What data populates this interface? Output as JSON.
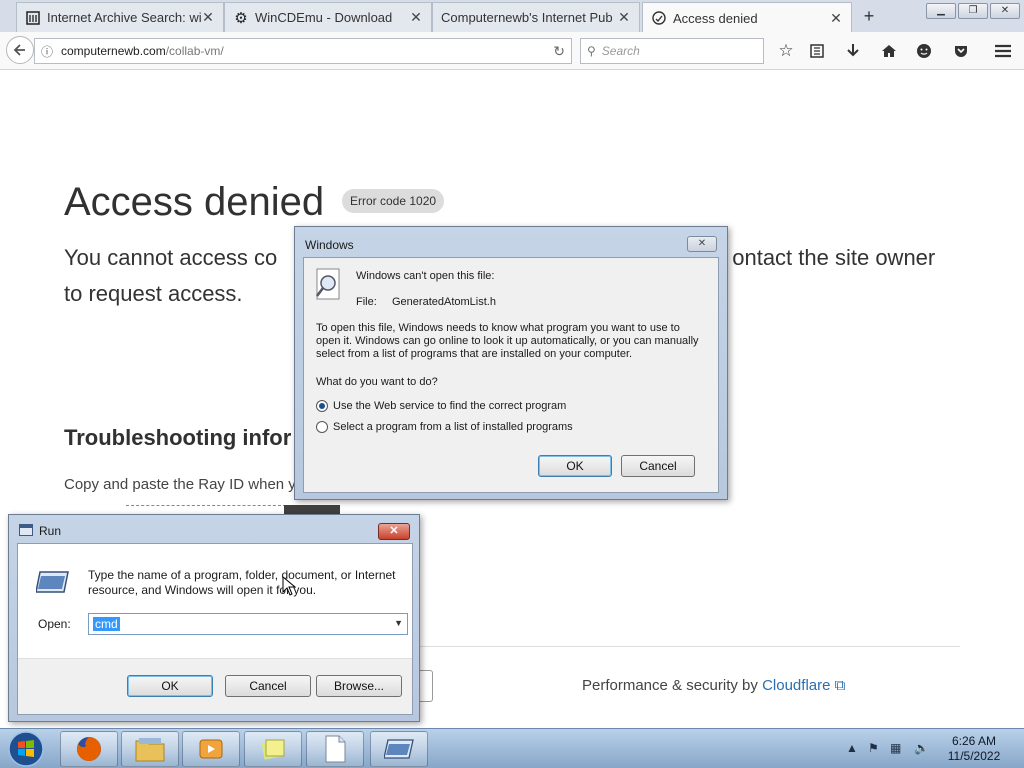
{
  "browser": {
    "tabs": [
      {
        "title": "Internet Archive Search: wi..."
      },
      {
        "title": "WinCDEmu - Download"
      },
      {
        "title": "Computernewb's Internet Pub ..."
      },
      {
        "title": "Access denied"
      }
    ],
    "url_host": "computernewb.com",
    "url_path": "/collab-vm/",
    "search_placeholder": "Search"
  },
  "page": {
    "title": "Access denied",
    "error_code": "Error code 1020",
    "message": "You cannot access co",
    "message_right": "ontact the site owner",
    "message_line2": "to request access.",
    "troubleshoot_heading": "Troubleshooting infor",
    "copy_text": "Copy and paste the Ray ID when y",
    "footer_text": "Performance & security by",
    "footer_link": "Cloudflare"
  },
  "windows_dialog": {
    "title": "Windows",
    "cant_open": "Windows can't open this file:",
    "file_label": "File:",
    "file_name": "GeneratedAtomList.h",
    "description": "To open this file, Windows needs to know what program you want to use to open it. Windows can go online to look it up automatically, or you can manually select from a list of programs that are installed on your computer.",
    "question": "What do you want to do?",
    "options": [
      {
        "label": "Use the Web service to find the correct program",
        "selected": true
      },
      {
        "label": "Select a program from a list of installed programs",
        "selected": false
      }
    ],
    "ok": "OK",
    "cancel": "Cancel"
  },
  "run_dialog": {
    "title": "Run",
    "description": "Type the name of a program, folder, document, or Internet resource, and Windows will open it for you.",
    "open_label": "Open:",
    "input_value": "cmd",
    "ok": "OK",
    "cancel": "Cancel",
    "browse": "Browse..."
  },
  "taskbar": {
    "time": "6:26 AM",
    "date": "11/5/2022"
  },
  "colors": {
    "link": "#2a6fb0",
    "selection": "#3399ff",
    "taskbar": "#9fbbdb"
  }
}
